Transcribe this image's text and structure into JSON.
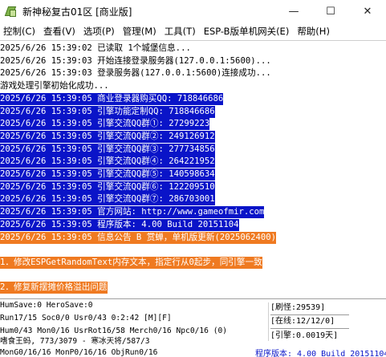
{
  "window": {
    "title": "新神秘复古01区 [商业版]",
    "minimize_glyph": "—",
    "maximize_glyph": "☐",
    "close_glyph": "✕"
  },
  "menu": [
    "控制(C)",
    "查看(V)",
    "选项(P)",
    "管理(M)",
    "工具(T)",
    "ESP-B版单机网关(E)",
    "帮助(H)"
  ],
  "log": [
    {
      "text": "2025/6/26 15:39:02 已读取 1个城堡信息...",
      "style": "normal"
    },
    {
      "text": "2025/6/26 15:39:03 开始连接登录服务器(127.0.0.1:5600)...",
      "style": "normal"
    },
    {
      "text": "2025/6/26 15:39:03 登录服务器(127.0.0.1:5600)连接成功...",
      "style": "normal"
    },
    {
      "text": "游戏处理引擎初始化成功...",
      "style": "normal"
    },
    {
      "text": "2025/6/26 15:39:05 商业登录器购买QQ: 718846686",
      "style": "blue"
    },
    {
      "text": "2025/6/26 15:39:05 引擎功能定制QQ: 718846686",
      "style": "blue"
    },
    {
      "text": "2025/6/26 15:39:05 引擎交流QQ群①: 27299223",
      "style": "blue"
    },
    {
      "text": "2025/6/26 15:39:05 引擎交流QQ群②: 249126912",
      "style": "blue"
    },
    {
      "text": "2025/6/26 15:39:05 引擎交流QQ群③: 277734856",
      "style": "blue"
    },
    {
      "text": "2025/6/26 15:39:05 引擎交流QQ群④: 264221952",
      "style": "blue"
    },
    {
      "text": "2025/6/26 15:39:05 引擎交流QQ群⑤: 140598634",
      "style": "blue"
    },
    {
      "text": "2025/6/26 15:39:05 引擎交流QQ群⑥: 122209510",
      "style": "blue"
    },
    {
      "text": "2025/6/26 15:39:05 引擎交流QQ群⑦: 286703001",
      "style": "blue"
    },
    {
      "text": "2025/6/26 15:39:05 官方网站: http://www.gameofmir.com",
      "style": "blue"
    },
    {
      "text": "2025/6/26 15:39:05 程序版本: 4.00 Build 20151104",
      "style": "blue"
    },
    {
      "text": "2025/6/26 15:39:05 信息公告 B 赏蝉，单机版更新(2025062400)",
      "style": "orange"
    },
    {
      "text": "",
      "style": "normal"
    },
    {
      "text": "1．修改ESPGetRandomText内存文本，指定行从0起步，同引擎一致",
      "style": "orange"
    },
    {
      "text": "",
      "style": "normal"
    },
    {
      "text": "2．修复新摆摊价格溢出问题",
      "style": "orange"
    }
  ],
  "status": {
    "lines": [
      "HumSave:0 HeroSave:0",
      "Run17/15 Soc0/0 Usr0/43                  0:2:42 [M][F]",
      "Hum0/43 Mon0/16 UsrRot16/58 Merch0/16 Npc0/16 (0)",
      "嗜食王蚂, 773/3079 - 寒冰天将/587/3",
      "MonG0/16/16 MonP0/16/16 ObjRun0/16"
    ],
    "refresh": "[刷怪:29539]",
    "online": "[在线:12/12/0]",
    "engine": "[引擎:0.0019天]",
    "version": "程序版本: 4.00 Build 20151104"
  }
}
